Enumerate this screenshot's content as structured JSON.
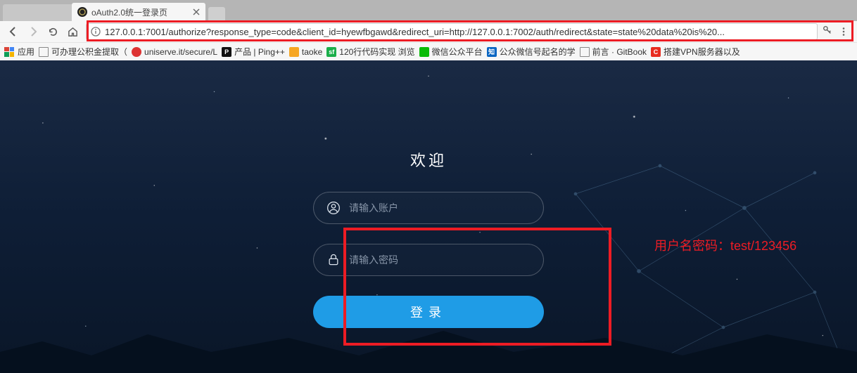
{
  "tab": {
    "title": "oAuth2.0统一登录页"
  },
  "url": "127.0.0.1:7001/authorize?response_type=code&client_id=hyewfbgawd&redirect_uri=http://127.0.0.1:7002/auth/redirect&state=state%20data%20is%20...",
  "bookmarks": {
    "apps_label": "应用",
    "items": [
      {
        "label": "可办理公积金提取（",
        "icon": "file"
      },
      {
        "label": "uniserve.it/secure/L",
        "icon": "red-circle"
      },
      {
        "label": "产品 | Ping++",
        "icon": "black-sq"
      },
      {
        "label": "taoke",
        "icon": "orange-sq"
      },
      {
        "label": "120行代码实现 浏览",
        "icon": "green-sf"
      },
      {
        "label": "微信公众平台",
        "icon": "wechat"
      },
      {
        "label": "公众微信号起名的学",
        "icon": "zhi"
      },
      {
        "label": "前言 · GitBook",
        "icon": "file"
      },
      {
        "label": "搭建VPN服务器以及",
        "icon": "red-c"
      }
    ]
  },
  "page": {
    "welcome": "欢迎",
    "username_placeholder": "请输入账户",
    "password_placeholder": "请输入密码",
    "login_label": "登录"
  },
  "annotation": {
    "credentials": "用户名密码：test/123456"
  }
}
